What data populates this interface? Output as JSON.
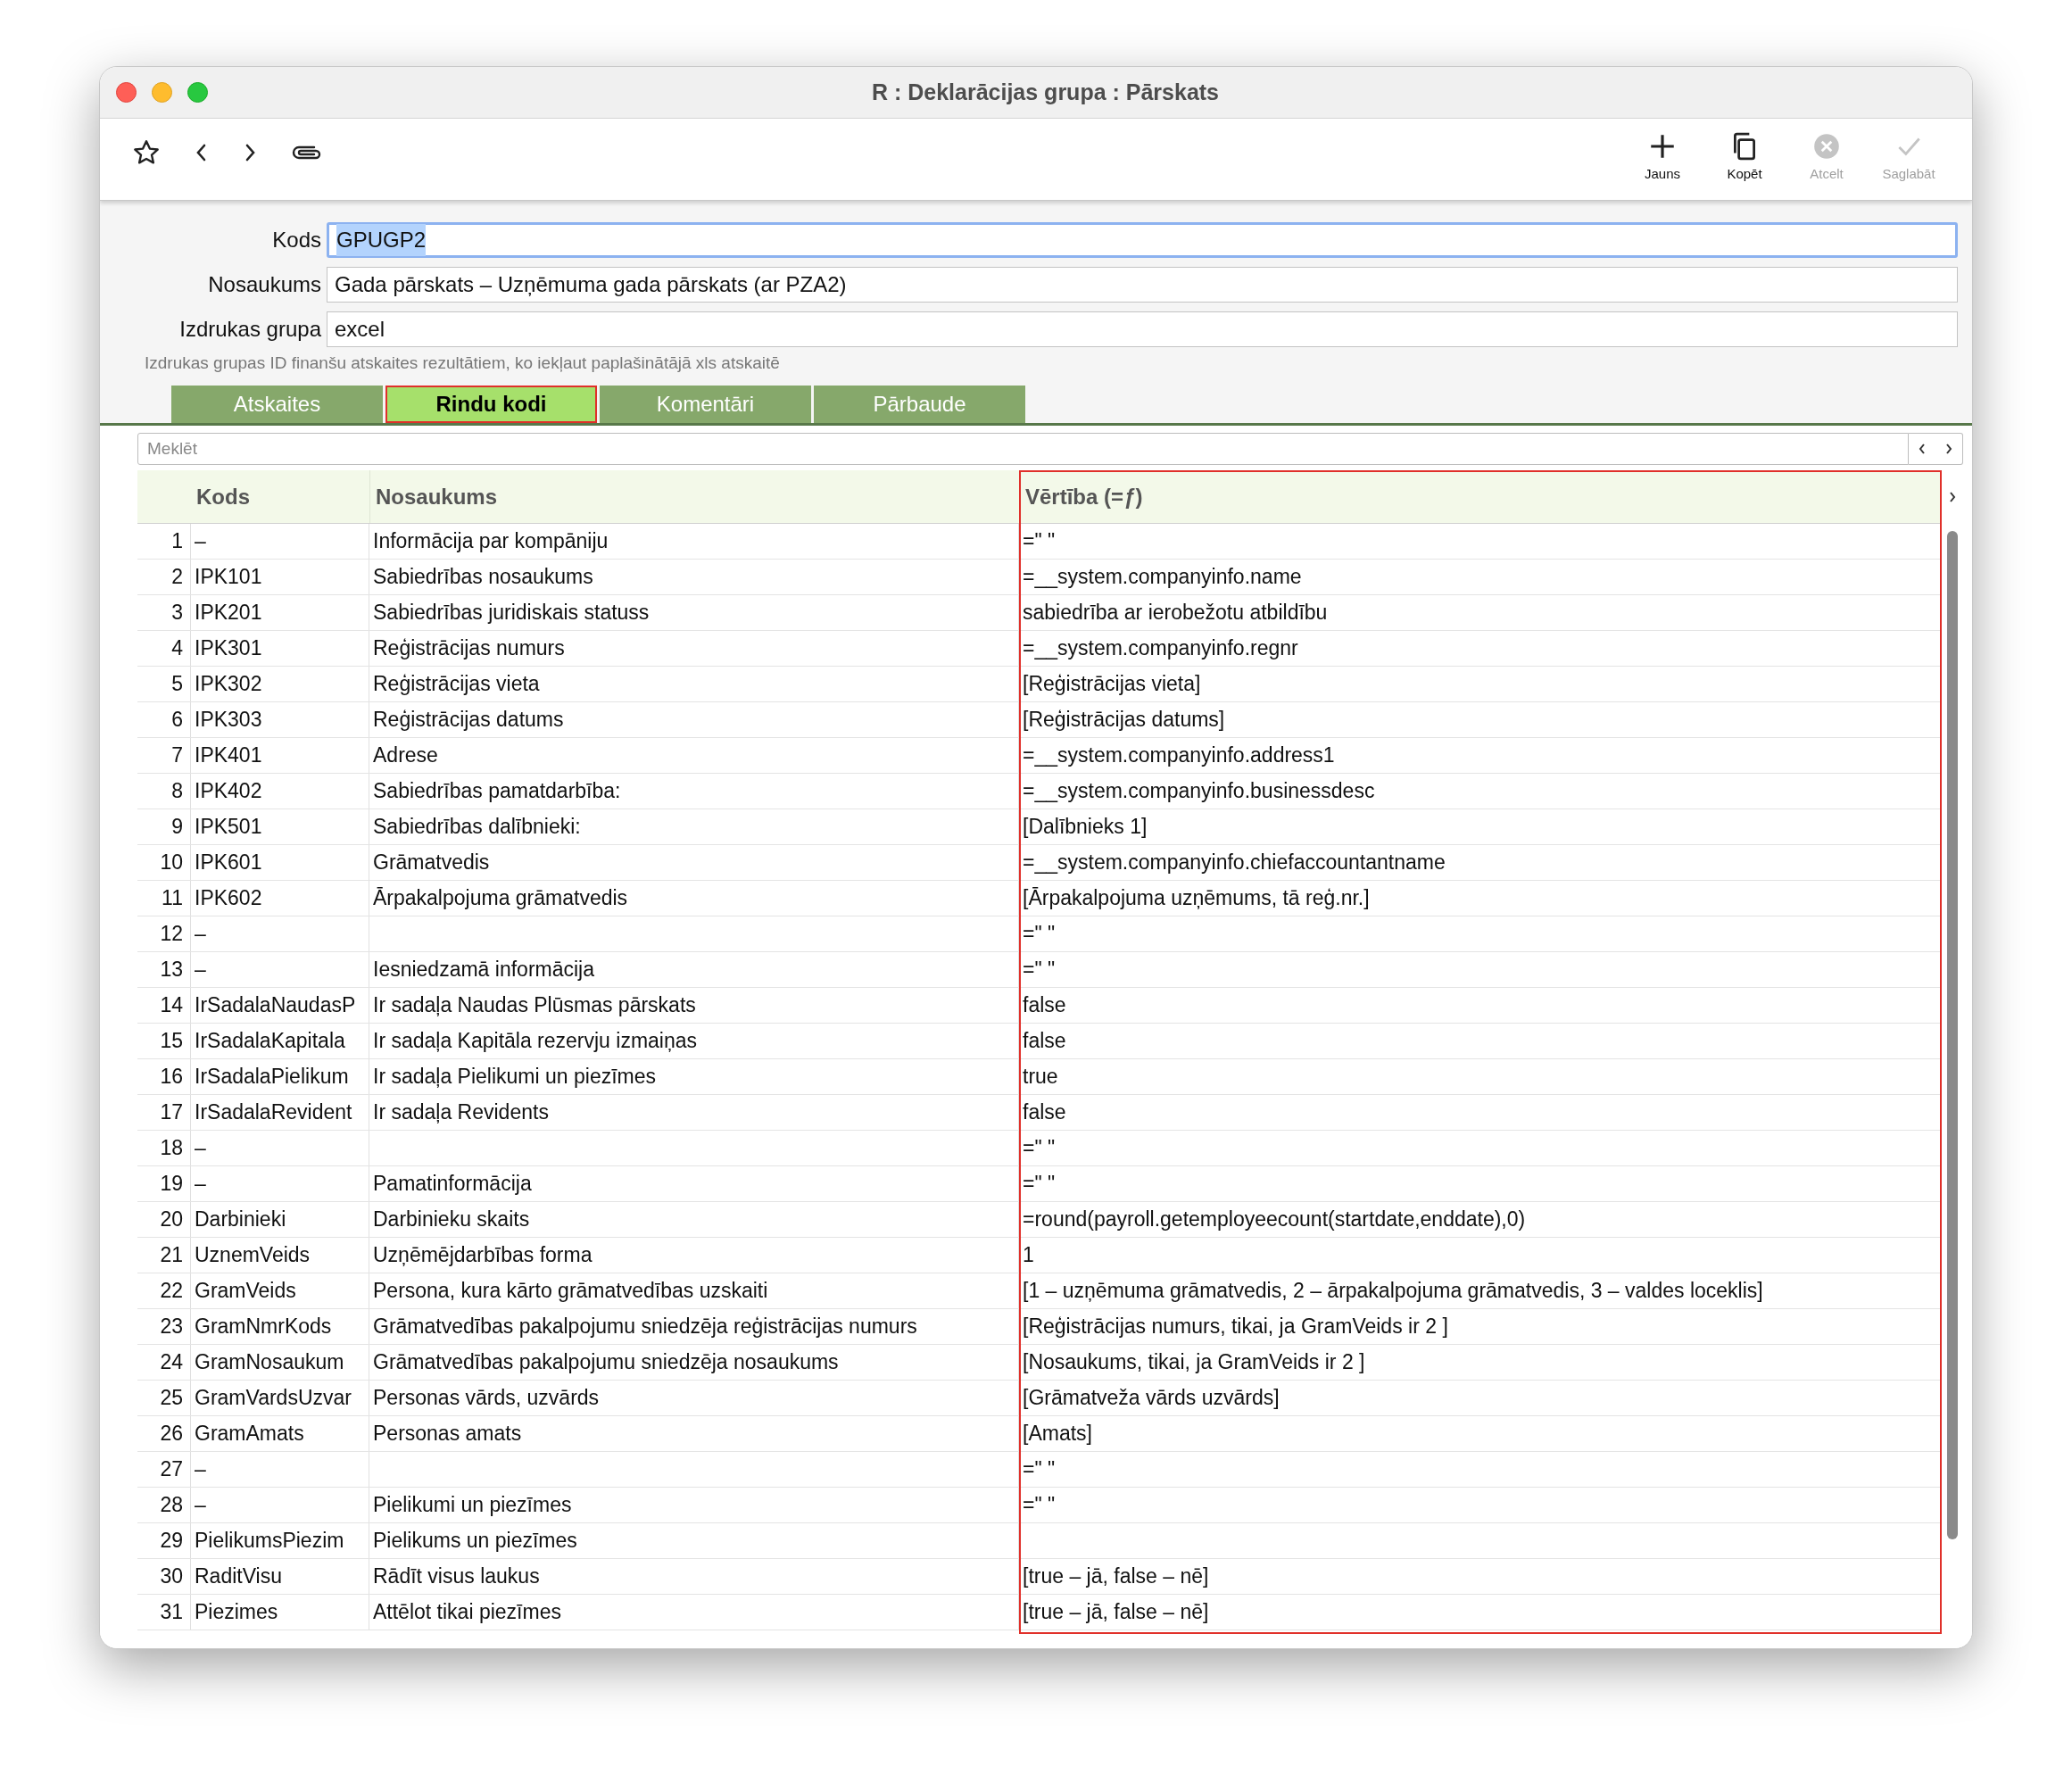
{
  "window": {
    "title": "R : Deklarācijas grupa : Pārskats"
  },
  "toolbar_actions": [
    {
      "kind": "add",
      "label": "Jauns",
      "disabled": false
    },
    {
      "kind": "copy",
      "label": "Kopēt",
      "disabled": false
    },
    {
      "kind": "cancel",
      "label": "Atcelt",
      "disabled": true
    },
    {
      "kind": "save",
      "label": "Saglabāt",
      "disabled": true
    }
  ],
  "form": {
    "fields": [
      {
        "label": "Kods",
        "value": "GPUGP2",
        "focused": true
      },
      {
        "label": "Nosaukums",
        "value": "Gada pārskats – Uzņēmuma gada pārskats (ar PZA2)",
        "focused": false
      },
      {
        "label": "Izdrukas grupa",
        "value": "excel",
        "focused": false
      }
    ],
    "hint": "Izdrukas grupas ID finanšu atskaites rezultātiem, ko iekļaut paplašinātājā xls atskaitē"
  },
  "tabs": [
    {
      "label": "Atskaites",
      "selected": false
    },
    {
      "label": "Rindu kodi",
      "selected": true
    },
    {
      "label": "Komentāri",
      "selected": false
    },
    {
      "label": "Pārbaude",
      "selected": false
    }
  ],
  "search": {
    "placeholder": "Meklēt"
  },
  "table": {
    "columns": [
      "Kods",
      "Nosaukums",
      "Vērtība (=*ƒ*)"
    ],
    "rows": [
      {
        "number": "1",
        "code": "–",
        "name": "Informācija par kompāniju",
        "value": "=\" \""
      },
      {
        "number": "2",
        "code": "IPK101",
        "name": "Sabiedrības nosaukums",
        "value": "=__system.companyinfo.name"
      },
      {
        "number": "3",
        "code": "IPK201",
        "name": "Sabiedrības juridiskais statuss",
        "value": "sabiedrība ar ierobežotu atbildību"
      },
      {
        "number": "4",
        "code": "IPK301",
        "name": "Reģistrācijas numurs",
        "value": "=__system.companyinfo.regnr"
      },
      {
        "number": "5",
        "code": "IPK302",
        "name": "Reģistrācijas vieta",
        "value": "[Reģistrācijas vieta]"
      },
      {
        "number": "6",
        "code": "IPK303",
        "name": "Reģistrācijas datums",
        "value": "[Reģistrācijas datums]"
      },
      {
        "number": "7",
        "code": "IPK401",
        "name": "Adrese",
        "value": "=__system.companyinfo.address1"
      },
      {
        "number": "8",
        "code": "IPK402",
        "name": "Sabiedrības pamatdarbība:",
        "value": "=__system.companyinfo.businessdesc"
      },
      {
        "number": "9",
        "code": "IPK501",
        "name": "Sabiedrības dalībnieki:",
        "value": "[Dalībnieks 1]"
      },
      {
        "number": "10",
        "code": "IPK601",
        "name": "Grāmatvedis",
        "value": "=__system.companyinfo.chiefaccountantname"
      },
      {
        "number": "11",
        "code": "IPK602",
        "name": "Ārpakalpojuma grāmatvedis",
        "value": "[Ārpakalpojuma uzņēmums, tā reģ.nr.]"
      },
      {
        "number": "12",
        "code": "–",
        "value": "=\" \""
      },
      {
        "number": "13",
        "code": "–",
        "name": "Iesniedzamā informācija",
        "value": "=\" \""
      },
      {
        "number": "14",
        "code": "IrSadalaNaudasP",
        "name": "Ir sadaļa Naudas Plūsmas pārskats",
        "value": "false"
      },
      {
        "number": "15",
        "code": "IrSadalaKapitala",
        "name": "Ir sadaļa Kapitāla rezervju izmaiņas",
        "value": "false"
      },
      {
        "number": "16",
        "code": "IrSadalaPielikum",
        "name": "Ir sadaļa Pielikumi un piezīmes",
        "value": "true"
      },
      {
        "number": "17",
        "code": "IrSadalaRevident",
        "name": "Ir sadaļa Revidents",
        "value": "false"
      },
      {
        "number": "18",
        "code": "–",
        "value": "=\" \""
      },
      {
        "number": "19",
        "code": "–",
        "name": "Pamatinformācija",
        "value": "=\" \""
      },
      {
        "number": "20",
        "code": "Darbinieki",
        "name": "Darbinieku skaits",
        "value": "=round(payroll.getemployeecount(startdate,enddate),0)"
      },
      {
        "number": "21",
        "code": "UznemVeids",
        "name": "Uzņēmējdarbības forma",
        "value": "1"
      },
      {
        "number": "22",
        "code": "GramVeids",
        "name": "Persona, kura kārto grāmatvedības uzskaiti",
        "value": "[1 – uzņēmuma grāmatvedis, 2 – ārpakalpojuma grāmatvedis, 3 – valdes loceklis]"
      },
      {
        "number": "23",
        "code": "GramNmrKods",
        "name": "Grāmatvedības pakalpojumu sniedzēja reģistrācijas numurs",
        "value": "[Reģistrācijas numurs, tikai, ja GramVeids ir 2 ]"
      },
      {
        "number": "24",
        "code": "GramNosaukum",
        "name": "Grāmatvedības pakalpojumu sniedzēja nosaukums",
        "value": "[Nosaukums, tikai, ja GramVeids ir 2 ]"
      },
      {
        "number": "25",
        "code": "GramVardsUzvar",
        "name": "Personas vārds, uzvārds",
        "value": "[Grāmatveža vārds uzvārds]"
      },
      {
        "number": "26",
        "code": "GramAmats",
        "name": "Personas amats",
        "value": "[Amats]"
      },
      {
        "number": "27",
        "code": "–",
        "value": "=\" \""
      },
      {
        "number": "28",
        "code": "–",
        "name": "Pielikumi un piezīmes",
        "value": "=\" \""
      },
      {
        "number": "29",
        "code": "PielikumsPiezim",
        "name": "Pielikums un piezīmes"
      },
      {
        "number": "30",
        "code": "RaditVisu",
        "name": "Rādīt visus laukus",
        "value": "[true – jā, false – nē]"
      },
      {
        "number": "31",
        "code": "Piezimes",
        "name": "Attēlot tikai piezīmes",
        "value": "[true – jā, false – nē]"
      }
    ]
  }
}
